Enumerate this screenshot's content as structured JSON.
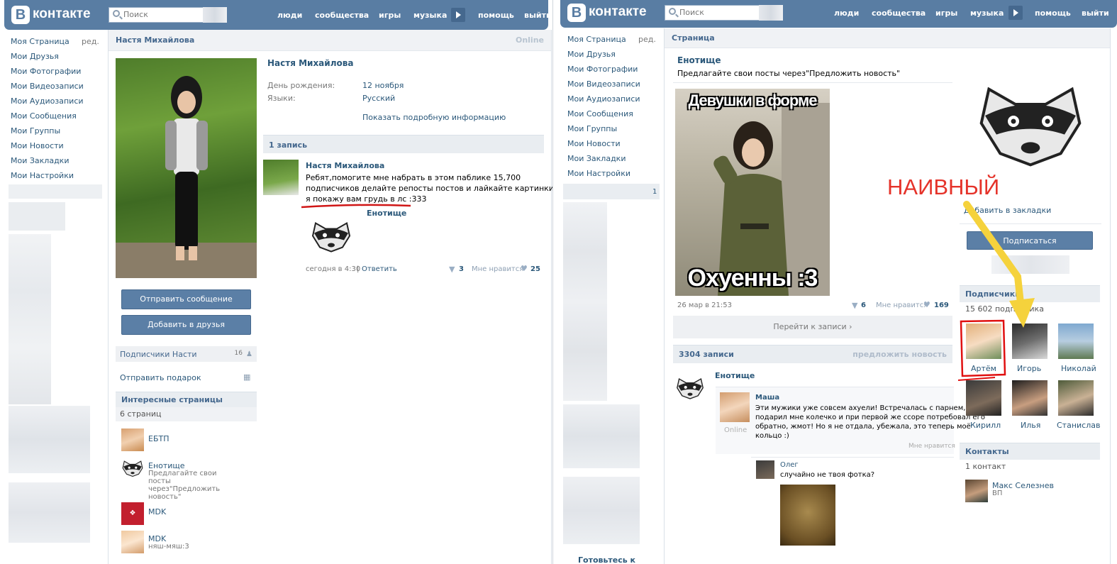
{
  "header": {
    "logo_letter": "В",
    "logo_text": "контакте",
    "search_placeholder": "Поиск",
    "nav": [
      "люди",
      "сообщества",
      "игры",
      "музыка",
      "помощь",
      "выйти"
    ]
  },
  "sidebar": {
    "items": [
      "Моя Страница",
      "Мои Друзья",
      "Мои Фотографии",
      "Мои Видеозаписи",
      "Мои Аудиозаписи",
      "Мои Сообщения",
      "Мои Группы",
      "Мои Новости",
      "Мои Закладки",
      "Мои Настройки"
    ],
    "edit_label": "ред."
  },
  "left_page": {
    "title": "Настя Михайлова",
    "status": "Online",
    "name": "Настя Михайлова",
    "info": [
      {
        "label": "День рождения:",
        "value": "12 ноября"
      },
      {
        "label": "Языки:",
        "value": "Русский"
      }
    ],
    "more_info": "Показать подробную информацию",
    "send_message": "Отправить сообщение",
    "add_friend": "Добавить в друзья",
    "followers_label": "Подписчики Насти",
    "followers_count": "16",
    "send_gift": "Отправить подарок",
    "interesting_title": "Интересные страницы",
    "interesting_count": "6 страниц",
    "pages": [
      {
        "name": "ЕБТП",
        "desc": ""
      },
      {
        "name": "Енотище",
        "desc": "Предлагайте свои посты через\"Предложить новость\""
      },
      {
        "name": "MDK",
        "desc": ""
      },
      {
        "name": "MDK",
        "desc": "няш-мяш:3"
      }
    ],
    "wall_count": "1 запись",
    "post": {
      "author": "Настя Михайлова",
      "text_lines": [
        "Ребят,помогите мне набрать в этом паблике 15,700",
        "подписчиков делайте репосты постов и лайкайте картинки и",
        "я покажу вам грудь в лс :333"
      ],
      "repost_name": "Енотище",
      "time": "сегодня в 4:30",
      "reply": "Ответить",
      "reposts": "3",
      "likes_label": "Мне нравится",
      "likes": "25"
    }
  },
  "right_page": {
    "sidebar_badge": "1",
    "sidebar_bottom": "Готовьтесь к",
    "title": "Страница",
    "group_name": "Енотище",
    "group_status": "Предлагайте свои посты через\"Предложить новость\"",
    "image_top_text": "Девушки в форме",
    "image_bottom_text": "Охуенны :3",
    "post_time": "26 мар в 21:53",
    "reposts": "6",
    "likes_label": "Мне нравится",
    "likes": "169",
    "goto_post": "Перейти к записи",
    "wall_count": "3304 записи",
    "suggest": "предложить новость",
    "wall_author": "Енотище",
    "comment1": {
      "author": "Маша",
      "online": "Online",
      "text_lines": [
        "Эти мужики уже совсем ахуели! Встречалась с парнем, он",
        "подарил мне колечко и при первой же ссоре потребовал его",
        "обратно, жмот! Но я не отдала, убежала, это теперь моё",
        "кольцо :)"
      ],
      "like": "Мне нравится"
    },
    "comment2": {
      "author": "Олег",
      "text": "случайно не твоя фотка?"
    },
    "bookmark": "Добавить в закладки",
    "subscribe": "Подписаться",
    "followers_title": "Подписчики",
    "followers_count": "15 602 подписчика",
    "followers": [
      "Артём",
      "Игорь",
      "Николай",
      "Кирилл",
      "Илья",
      "Станислав"
    ],
    "contacts_title": "Контакты",
    "contacts_count": "1 контакт",
    "contact_name": "Макс Селезнев",
    "contact_role": "ВП",
    "annotation": "НАИВНЫЙ"
  },
  "colors": {
    "header": "#597da3",
    "link": "#2b587a",
    "annotation_red": "#e5332a",
    "arrow_yellow": "#f5d23c"
  }
}
